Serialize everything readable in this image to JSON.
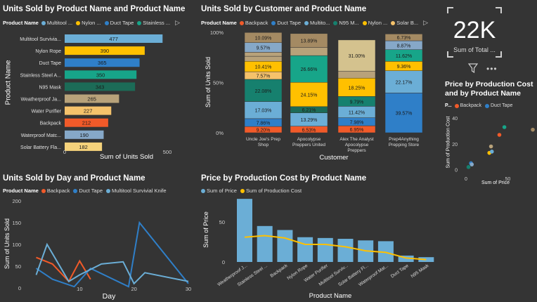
{
  "colors": {
    "blue": "#6baed6",
    "yellow": "#ffc000",
    "dblue": "#2f7fc8",
    "teal": "#17a589",
    "dteal": "#16806e",
    "tan": "#b8a27a",
    "peach": "#f5c26b",
    "orange": "#f15a29",
    "gray": "#86a8c8",
    "brown": "#a48a63",
    "darkgreen": "#1c6b57"
  },
  "t1": {
    "title": "Units Sold by Product Name and Product Name",
    "legend_label": "Product Name",
    "legend": [
      "Multitool ...",
      "Nylon ...",
      "Duct Tape",
      "Stainless ..."
    ],
    "legend_colors": [
      "#6baed6",
      "#ffc000",
      "#2f7fc8",
      "#17a589"
    ],
    "ylabel": "Product Name",
    "xlabel": "Sum of Units Sold",
    "ticks": [
      "0",
      "500"
    ]
  },
  "t2": {
    "title": "Units Sold by Customer and Product Name",
    "legend_label": "Product Name",
    "legend": [
      "Backpack",
      "Duct Tape",
      "Multito...",
      "N95 M...",
      "Nylon ...",
      "Solar B..."
    ],
    "legend_colors": [
      "#f15a29",
      "#2f7fc8",
      "#6baed6",
      "#16806e",
      "#ffc000",
      "#b8a27a"
    ],
    "ylabel": "Sum of Units Sold",
    "xlabel": "Customer",
    "yticks": [
      "100%",
      "50%",
      "0%"
    ]
  },
  "kpi": {
    "value": "22K",
    "label": "Sum of Total ..."
  },
  "t3": {
    "title_line1": "Price by Production Cost",
    "title_line2": "and by Product Name",
    "legend_label": "P...",
    "legend": [
      "Backpack",
      "Duct Tape"
    ],
    "legend_colors": [
      "#f15a29",
      "#2f7fc8"
    ],
    "ylabel": "Sum of Production Cost",
    "xlabel": "Sum of Price",
    "yticks": [
      "40",
      "20",
      "0"
    ],
    "xticks": [
      "0",
      "50"
    ]
  },
  "t4": {
    "title": "Units Sold by Day and Product Name",
    "legend_label": "Product Name",
    "legend": [
      "Backpack",
      "Duct Tape",
      "Multitool Survivial Knife"
    ],
    "legend_colors": [
      "#f15a29",
      "#2f7fc8",
      "#6baed6"
    ],
    "ylabel": "Sum of Units Sold",
    "xlabel": "Day",
    "yticks": [
      "200",
      "150",
      "100",
      "50",
      "0"
    ],
    "xticks": [
      "10",
      "20",
      "30"
    ]
  },
  "t5": {
    "title": "Price by Production Cost by Product Name",
    "legend": [
      "Sum of Price",
      "Sum of Production Cost"
    ],
    "legend_colors": [
      "#6baed6",
      "#ffc000"
    ],
    "ylabel": "Sum of Price",
    "xlabel": "Product Name",
    "yticks": [
      "50",
      "0"
    ]
  },
  "chart_data": [
    {
      "type": "bar",
      "orientation": "horizontal",
      "title": "Units Sold by Product Name and Product Name",
      "categories": [
        "Multitool Survivia...",
        "Nylon Rope",
        "Duct Tape",
        "Stainless Steel A...",
        "N95 Mask",
        "Weatherproof Ja...",
        "Water Purifier",
        "Backpack",
        "Waterproof Matc...",
        "Solar Battery Fla..."
      ],
      "values": [
        477,
        390,
        365,
        350,
        343,
        265,
        227,
        212,
        190,
        182
      ],
      "colors": [
        "#6baed6",
        "#ffc000",
        "#2f7fc8",
        "#17a589",
        "#1c6b57",
        "#b8a27a",
        "#f5c26b",
        "#f15a29",
        "#86a8c8",
        "#f5d27b"
      ],
      "xlabel": "Sum of Units Sold",
      "ylabel": "Product Name",
      "xlim": [
        0,
        500
      ]
    },
    {
      "type": "bar",
      "stacked": "100%",
      "title": "Units Sold by Customer and Product Name",
      "categories": [
        "Uncle Joe's Prep Shop",
        "Apocolypse Preppers United",
        "Alex The Analyst Apocolypse Preppers",
        "Prep4Anything Prepping Store"
      ],
      "ylabel": "Sum of Units Sold",
      "xlabel": "Customer",
      "segments": [
        [
          {
            "value": 6.2,
            "label": "9.20%",
            "color": "#f15a29"
          },
          {
            "value": 7.86,
            "label": "7.86%",
            "color": "#2f7fc8"
          },
          {
            "value": 17.03,
            "label": "17.03%",
            "color": "#6baed6"
          },
          {
            "value": 22.08,
            "label": "22.08%",
            "color": "#16806e"
          },
          {
            "value": 7.57,
            "label": "7.57%",
            "color": "#f5c26b"
          },
          {
            "value": 10.41,
            "label": "10.41%",
            "color": "#ffc000"
          },
          {
            "value": 5.0,
            "label": "",
            "color": "#b8a27a"
          },
          {
            "value": 4.0,
            "label": "",
            "color": "#b8a27a"
          },
          {
            "value": 9.57,
            "label": "9.57%",
            "color": "#86a8c8"
          },
          {
            "value": 10.09,
            "label": "10.09%",
            "color": "#a48a63"
          }
        ],
        [
          {
            "value": 6.53,
            "label": "6.53%",
            "color": "#f15a29"
          },
          {
            "value": 13.29,
            "label": "13.29%",
            "color": "#6baed6"
          },
          {
            "value": 6.21,
            "label": "6.21%",
            "color": "#1c6b57"
          },
          {
            "value": 24.15,
            "label": "24.15%",
            "color": "#ffc000"
          },
          {
            "value": 26.66,
            "label": "26.66%",
            "color": "#17a589"
          },
          {
            "value": 8.0,
            "label": "",
            "color": "#b8a27a"
          },
          {
            "value": 13.89,
            "label": "13.89%",
            "color": "#a48a63"
          }
        ],
        [
          {
            "value": 6.95,
            "label": "6.95%",
            "color": "#f15a29"
          },
          {
            "value": 7.98,
            "label": "7.98%",
            "color": "#2f7fc8"
          },
          {
            "value": 11.42,
            "label": "11.42%",
            "color": "#6baed6"
          },
          {
            "value": 9.79,
            "label": "9.79%",
            "color": "#16806e"
          },
          {
            "value": 18.25,
            "label": "18.25%",
            "color": "#ffc000"
          },
          {
            "value": 7.0,
            "label": "",
            "color": "#b8a27a"
          },
          {
            "value": 31.0,
            "label": "31.00%",
            "color": "#d4c28e"
          }
        ],
        [
          {
            "value": 39.57,
            "label": "39.57%",
            "color": "#2f7fc8"
          },
          {
            "value": 22.17,
            "label": "22.17%",
            "color": "#6baed6"
          },
          {
            "value": 9.36,
            "label": "9.36%",
            "color": "#ffc000"
          },
          {
            "value": 11.62,
            "label": "11.62%",
            "color": "#17a589"
          },
          {
            "value": 8.87,
            "label": "8.87%",
            "color": "#86a8c8"
          },
          {
            "value": 6.73,
            "label": "6.73%",
            "color": "#a48a63"
          }
        ]
      ]
    },
    {
      "type": "scatter",
      "title": "Price by Production Cost and by Product Name",
      "xlabel": "Sum of Price",
      "ylabel": "Sum of Production Cost",
      "points": [
        {
          "x": 3,
          "y": 2,
          "color": "#16806e"
        },
        {
          "x": 6,
          "y": 5,
          "color": "#2f7fc8"
        },
        {
          "x": 7,
          "y": 4,
          "color": "#86a8c8"
        },
        {
          "x": 28,
          "y": 13,
          "color": "#ffc000"
        },
        {
          "x": 30,
          "y": 18,
          "color": "#b8a27a"
        },
        {
          "x": 31,
          "y": 14,
          "color": "#6baed6"
        },
        {
          "x": 40,
          "y": 27,
          "color": "#f15a29"
        },
        {
          "x": 46,
          "y": 33,
          "color": "#17a589"
        },
        {
          "x": 80,
          "y": 31,
          "color": "#a48a63"
        }
      ],
      "xlim": [
        -5,
        80
      ],
      "ylim": [
        -3,
        45
      ]
    },
    {
      "type": "line",
      "title": "Units Sold by Day and Product Name",
      "xlabel": "Day",
      "ylabel": "Sum of Units Sold",
      "xlim": [
        0,
        30
      ],
      "ylim": [
        0,
        200
      ],
      "series": [
        {
          "name": "Backpack",
          "color": "#f15a29",
          "x": [
            2,
            5,
            8,
            10,
            12
          ],
          "y": [
            70,
            55,
            15,
            62,
            20
          ]
        },
        {
          "name": "Duct Tape",
          "color": "#2f7fc8",
          "x": [
            2,
            5,
            9,
            12,
            19,
            21,
            30
          ],
          "y": [
            45,
            20,
            3,
            45,
            3,
            150,
            10
          ]
        },
        {
          "name": "Multitool Survivial Knife",
          "color": "#6baed6",
          "x": [
            2,
            4,
            8,
            10,
            14,
            18,
            20,
            22,
            30
          ],
          "y": [
            30,
            100,
            15,
            30,
            55,
            60,
            10,
            35,
            15
          ]
        }
      ]
    },
    {
      "type": "bar",
      "title": "Price by Production Cost by Product Name",
      "xlabel": "Product Name",
      "ylabel": "Sum of Price",
      "ylim": [
        0,
        80
      ],
      "categories": [
        "Weatherproof J...",
        "Stainless Steel ...",
        "Backpack",
        "Nylon Rope",
        "Water Purifier",
        "Multitool Surviv...",
        "Solar Battery Fl...",
        "Waterproof Mat...",
        "Duct Tape",
        "N95 Mask"
      ],
      "series": [
        {
          "name": "Sum of Price",
          "type": "bar",
          "color": "#6baed6",
          "values": [
            79,
            45,
            40,
            31,
            30,
            29,
            27,
            26,
            8,
            6
          ]
        },
        {
          "name": "Sum of Production Cost",
          "type": "line",
          "color": "#ffc000",
          "values": [
            31,
            33,
            30,
            22,
            22,
            19,
            14,
            12,
            5,
            3
          ]
        }
      ]
    }
  ]
}
